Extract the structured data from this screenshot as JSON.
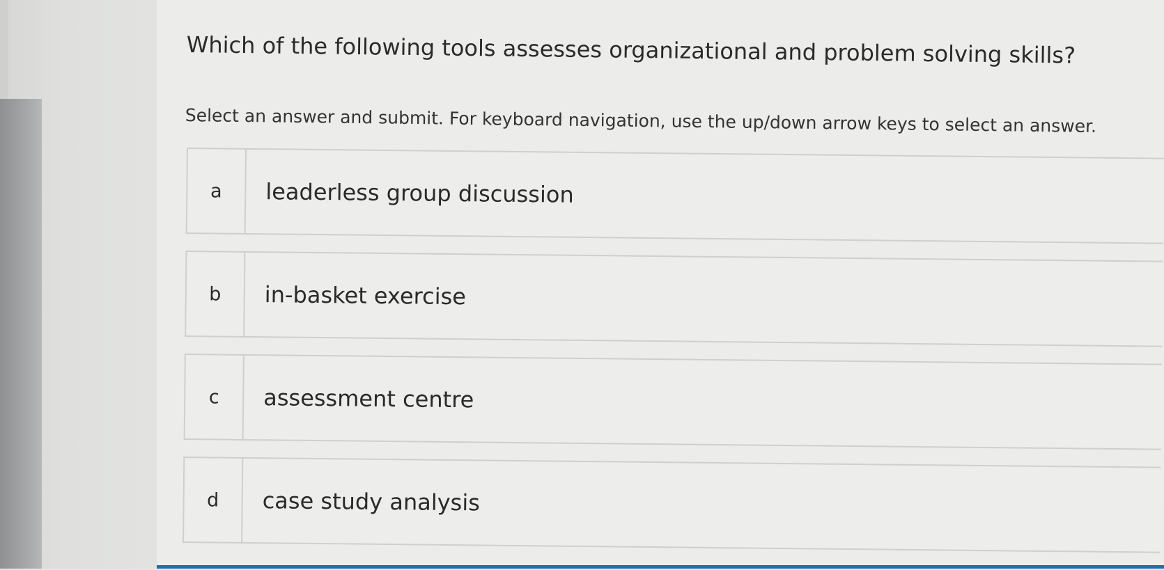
{
  "question": {
    "text": "Which of the following tools assesses organizational and problem solving skills?"
  },
  "instruction": "Select an answer and submit. For keyboard navigation, use the up/down arrow keys to select an answer.",
  "options": [
    {
      "letter": "a",
      "text": "leaderless group discussion"
    },
    {
      "letter": "b",
      "text": "in-basket exercise"
    },
    {
      "letter": "c",
      "text": "assessment centre"
    },
    {
      "letter": "d",
      "text": "case study analysis"
    }
  ],
  "colors": {
    "background": "#ececeb",
    "border": "#cfd0ce",
    "accent_bar": "#1d6fb3"
  }
}
